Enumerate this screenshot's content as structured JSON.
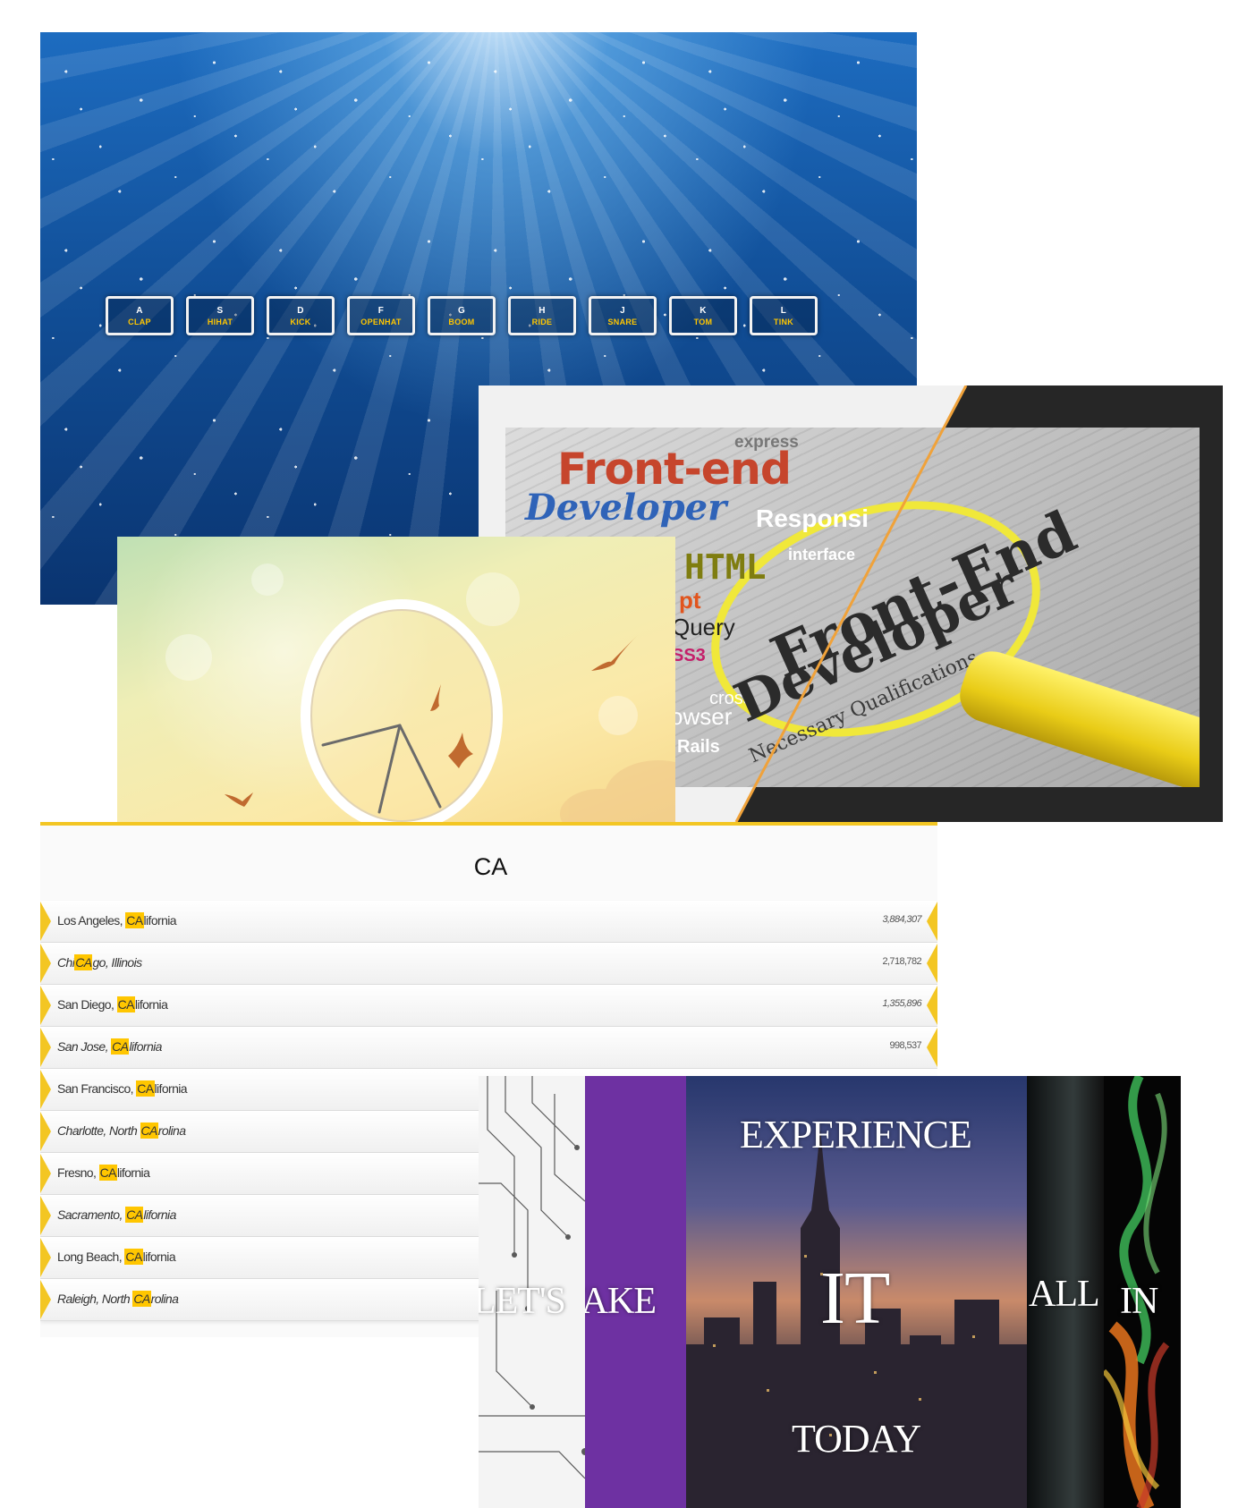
{
  "drum_kit": {
    "keys": [
      {
        "key": "A",
        "sound": "CLAP"
      },
      {
        "key": "S",
        "sound": "HIHAT"
      },
      {
        "key": "D",
        "sound": "KICK"
      },
      {
        "key": "F",
        "sound": "OPENHAT"
      },
      {
        "key": "G",
        "sound": "BOOM"
      },
      {
        "key": "H",
        "sound": "RIDE"
      },
      {
        "key": "J",
        "sound": "SNARE"
      },
      {
        "key": "K",
        "sound": "TOM"
      },
      {
        "key": "L",
        "sound": "TINK"
      }
    ]
  },
  "developer_image": {
    "words": {
      "express": "express",
      "front_end": "Front-end",
      "developer": "Developer",
      "responsive": "Responsi",
      "interface": "interface",
      "html": "HTML",
      "script": "pt",
      "query": "Query",
      "css": "SS3",
      "cross": "cross",
      "browser": "owser",
      "rails": "Rails",
      "news_front_end": "Front-End",
      "news_developer": "Developer",
      "necessary": "Necessary Qualifications"
    }
  },
  "type_ahead": {
    "search_value": "CA",
    "results": [
      {
        "before": "Los Angeles, ",
        "match": "CA",
        "after": "lifornia",
        "population": "3,884,307"
      },
      {
        "before": "Chi",
        "match": "CA",
        "after": "go, Illinois",
        "population": "2,718,782"
      },
      {
        "before": "San Diego, ",
        "match": "CA",
        "after": "lifornia",
        "population": "1,355,896"
      },
      {
        "before": "San Jose, ",
        "match": "CA",
        "after": "lifornia",
        "population": "998,537"
      },
      {
        "before": "San Francisco, ",
        "match": "CA",
        "after": "lifornia",
        "population": ""
      },
      {
        "before": "Charlotte, North ",
        "match": "CA",
        "after": "rolina",
        "population": ""
      },
      {
        "before": "Fresno, ",
        "match": "CA",
        "after": "lifornia",
        "population": ""
      },
      {
        "before": "Sacramento, ",
        "match": "CA",
        "after": "lifornia",
        "population": ""
      },
      {
        "before": "Long Beach, ",
        "match": "CA",
        "after": "lifornia",
        "population": ""
      },
      {
        "before": "Raleigh, North ",
        "match": "CA",
        "after": "rolina",
        "population": ""
      }
    ]
  },
  "flex_panels": {
    "panel1": "LET'S",
    "panel2": "STAKE",
    "panel3_top": "EXPERIENCE",
    "panel3_mid": "IT",
    "panel3_bottom": "TODAY",
    "panel4": "ALL",
    "panel5": "IN"
  },
  "colors": {
    "accent": "#ffc600",
    "border_yellow": "#f3c623",
    "purple_panel": "#6e31a2"
  }
}
